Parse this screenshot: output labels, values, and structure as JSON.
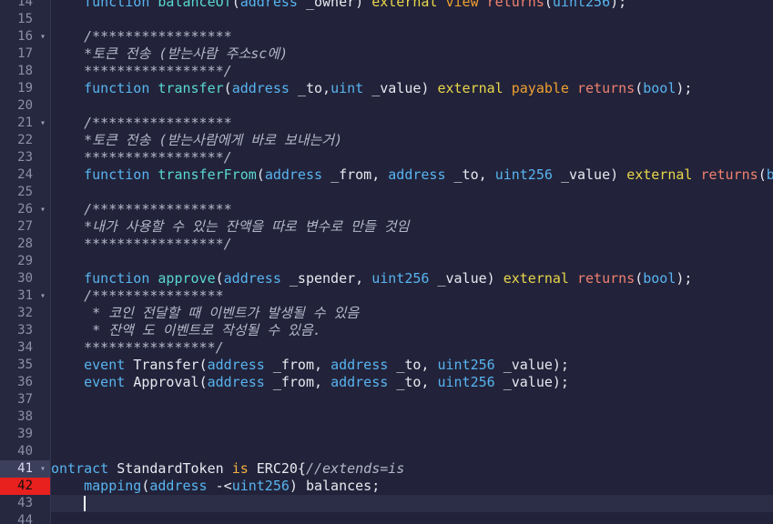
{
  "editor": {
    "current_line": "41",
    "error_line": "42",
    "cursor_line": "43"
  },
  "gutter": [
    {
      "n": "14",
      "fold": ""
    },
    {
      "n": "15",
      "fold": ""
    },
    {
      "n": "16",
      "fold": "▾"
    },
    {
      "n": "17",
      "fold": ""
    },
    {
      "n": "18",
      "fold": ""
    },
    {
      "n": "19",
      "fold": ""
    },
    {
      "n": "20",
      "fold": ""
    },
    {
      "n": "21",
      "fold": "▾"
    },
    {
      "n": "22",
      "fold": ""
    },
    {
      "n": "23",
      "fold": ""
    },
    {
      "n": "24",
      "fold": ""
    },
    {
      "n": "25",
      "fold": ""
    },
    {
      "n": "26",
      "fold": "▾"
    },
    {
      "n": "27",
      "fold": ""
    },
    {
      "n": "28",
      "fold": ""
    },
    {
      "n": "29",
      "fold": ""
    },
    {
      "n": "30",
      "fold": ""
    },
    {
      "n": "31",
      "fold": "▾"
    },
    {
      "n": "32",
      "fold": ""
    },
    {
      "n": "33",
      "fold": ""
    },
    {
      "n": "34",
      "fold": ""
    },
    {
      "n": "35",
      "fold": ""
    },
    {
      "n": "36",
      "fold": ""
    },
    {
      "n": "37",
      "fold": ""
    },
    {
      "n": "38",
      "fold": ""
    },
    {
      "n": "39",
      "fold": ""
    },
    {
      "n": "40",
      "fold": ""
    },
    {
      "n": "41",
      "fold": "▾"
    },
    {
      "n": "42",
      "fold": ""
    },
    {
      "n": "43",
      "fold": ""
    },
    {
      "n": "44",
      "fold": ""
    }
  ],
  "lines": [
    [
      [
        "    ",
        "plain"
      ],
      [
        "function ",
        "kw"
      ],
      [
        "balanceOf",
        "fn"
      ],
      [
        "(",
        "plain"
      ],
      [
        "address ",
        "kw"
      ],
      [
        "_owner) ",
        "plain"
      ],
      [
        "external ",
        "ext"
      ],
      [
        "view ",
        "pay"
      ],
      [
        "returns",
        "ret"
      ],
      [
        "(",
        "plain"
      ],
      [
        "uint256",
        "kw"
      ],
      [
        ");",
        "plain"
      ]
    ],
    [],
    [
      [
        "    /*****************",
        "com"
      ]
    ],
    [
      [
        "    *토큰 전송 (받는사람 주소sc에)",
        "com"
      ]
    ],
    [
      [
        "    *****************/",
        "com"
      ]
    ],
    [
      [
        "    ",
        "plain"
      ],
      [
        "function ",
        "kw"
      ],
      [
        "transfer",
        "fn"
      ],
      [
        "(",
        "plain"
      ],
      [
        "address ",
        "kw"
      ],
      [
        "_to,",
        "plain"
      ],
      [
        "uint ",
        "kw"
      ],
      [
        "_value) ",
        "plain"
      ],
      [
        "external ",
        "ext"
      ],
      [
        "payable ",
        "pay"
      ],
      [
        "returns",
        "ret"
      ],
      [
        "(",
        "plain"
      ],
      [
        "bool",
        "kw"
      ],
      [
        ");",
        "plain"
      ]
    ],
    [],
    [
      [
        "    /*****************",
        "com"
      ]
    ],
    [
      [
        "    *토큰 전송 (받는사람에게 바로 보내는거)",
        "com"
      ]
    ],
    [
      [
        "    *****************/",
        "com"
      ]
    ],
    [
      [
        "    ",
        "plain"
      ],
      [
        "function ",
        "kw"
      ],
      [
        "transferFrom",
        "fn"
      ],
      [
        "(",
        "plain"
      ],
      [
        "address ",
        "kw"
      ],
      [
        "_from, ",
        "plain"
      ],
      [
        "address ",
        "kw"
      ],
      [
        "_to, ",
        "plain"
      ],
      [
        "uint256 ",
        "kw"
      ],
      [
        "_value) ",
        "plain"
      ],
      [
        "external ",
        "ext"
      ],
      [
        "returns",
        "ret"
      ],
      [
        "(",
        "plain"
      ],
      [
        "bool",
        "kw"
      ],
      [
        ");",
        "plain"
      ]
    ],
    [],
    [
      [
        "    /*****************",
        "com"
      ]
    ],
    [
      [
        "    *내가 사용할 수 있는 잔액을 따로 변수로 만들 것임",
        "com"
      ]
    ],
    [
      [
        "    *****************/",
        "com"
      ]
    ],
    [],
    [
      [
        "    ",
        "plain"
      ],
      [
        "function ",
        "kw"
      ],
      [
        "approve",
        "fn"
      ],
      [
        "(",
        "plain"
      ],
      [
        "address ",
        "kw"
      ],
      [
        "_spender, ",
        "plain"
      ],
      [
        "uint256 ",
        "kw"
      ],
      [
        "_value) ",
        "plain"
      ],
      [
        "external ",
        "ext"
      ],
      [
        "returns",
        "ret"
      ],
      [
        "(",
        "plain"
      ],
      [
        "bool",
        "kw"
      ],
      [
        ");",
        "plain"
      ]
    ],
    [
      [
        "    /****************",
        "com"
      ]
    ],
    [
      [
        "     * 코인 전달할 때 이벤트가 발생될 수 있음",
        "com"
      ]
    ],
    [
      [
        "     * 잔액 도 이벤트로 작성될 수 있음.",
        "com"
      ]
    ],
    [
      [
        "    ****************/",
        "com"
      ]
    ],
    [
      [
        "    ",
        "plain"
      ],
      [
        "event ",
        "kw"
      ],
      [
        "Transfer",
        "plain"
      ],
      [
        "(",
        "plain"
      ],
      [
        "address ",
        "kw"
      ],
      [
        "_from, ",
        "plain"
      ],
      [
        "address ",
        "kw"
      ],
      [
        "_to, ",
        "plain"
      ],
      [
        "uint256 ",
        "kw"
      ],
      [
        "_value);",
        "plain"
      ]
    ],
    [
      [
        "    ",
        "plain"
      ],
      [
        "event ",
        "kw"
      ],
      [
        "Approval",
        "plain"
      ],
      [
        "(",
        "plain"
      ],
      [
        "address ",
        "kw"
      ],
      [
        "_from, ",
        "plain"
      ],
      [
        "address ",
        "kw"
      ],
      [
        "_to, ",
        "plain"
      ],
      [
        "uint256 ",
        "kw"
      ],
      [
        "_value);",
        "plain"
      ]
    ],
    [],
    [],
    [],
    [],
    [
      [
        "ontract ",
        "kw"
      ],
      [
        "StandardToken ",
        "plain"
      ],
      [
        "is ",
        "is"
      ],
      [
        "ERC20{",
        "plain"
      ],
      [
        "//extends=is",
        "com"
      ]
    ],
    [
      [
        "    ",
        "plain"
      ],
      [
        "mapping",
        "kw"
      ],
      [
        "(",
        "plain"
      ],
      [
        "address ",
        "kw"
      ],
      [
        "-<",
        "plain"
      ],
      [
        "uint256",
        "kw"
      ],
      [
        ") balances;",
        "plain"
      ]
    ],
    [
      [
        "    ",
        "plain"
      ]
    ],
    []
  ],
  "colors": {
    "background": "#22233a",
    "gutter": "#262840",
    "error_marker": "#e8201e",
    "keyword": "#58b4f0",
    "function_name": "#5ad8d0",
    "external": "#e8d64a",
    "returns": "#f08070",
    "comment": "#b4b7c8"
  }
}
